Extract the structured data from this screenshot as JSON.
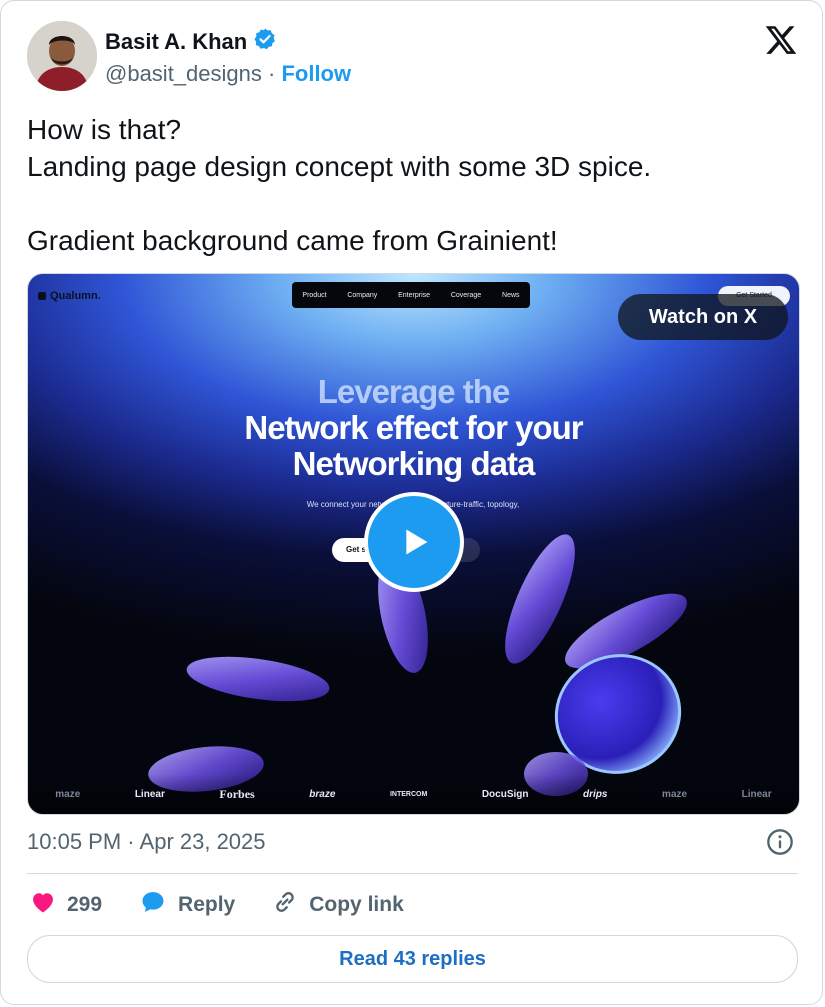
{
  "author": {
    "name": "Basit A. Khan",
    "handle": "@basit_designs",
    "separator": "·",
    "follow_label": "Follow",
    "verified": true
  },
  "tweet": {
    "text": "How is that?\nLanding page design concept with some 3D spice.\n\nGradient background came from Grainient!"
  },
  "media": {
    "brand": "Qualumn.",
    "nav": [
      "Product",
      "Company",
      "Enterprise",
      "Coverage",
      "News"
    ],
    "corner_button": "Get Started",
    "watch_label": "Watch on X",
    "headline_line1": "Leverage the",
    "headline_line2": "Network effect for your",
    "headline_line3": "Networking data",
    "subtext": "We connect your networking d... ger picture-traffic, topology,",
    "cta_primary": "Get s",
    "cta_secondary": "s",
    "small_note": "from net... s",
    "logos": [
      "maze",
      "Linear",
      "Forbes",
      "braze",
      "INTERCOM",
      "DocuSign",
      "drips",
      "maze",
      "Linear"
    ]
  },
  "meta": {
    "time": "10:05 PM",
    "separator": "·",
    "date": "Apr 23, 2025"
  },
  "actions": {
    "likes": "299",
    "reply_label": "Reply",
    "copy_label": "Copy link"
  },
  "read_replies": "Read 43 replies",
  "colors": {
    "accent": "#1d9bf0",
    "like": "#f91880",
    "text": "#0f1419",
    "muted": "#536471"
  }
}
